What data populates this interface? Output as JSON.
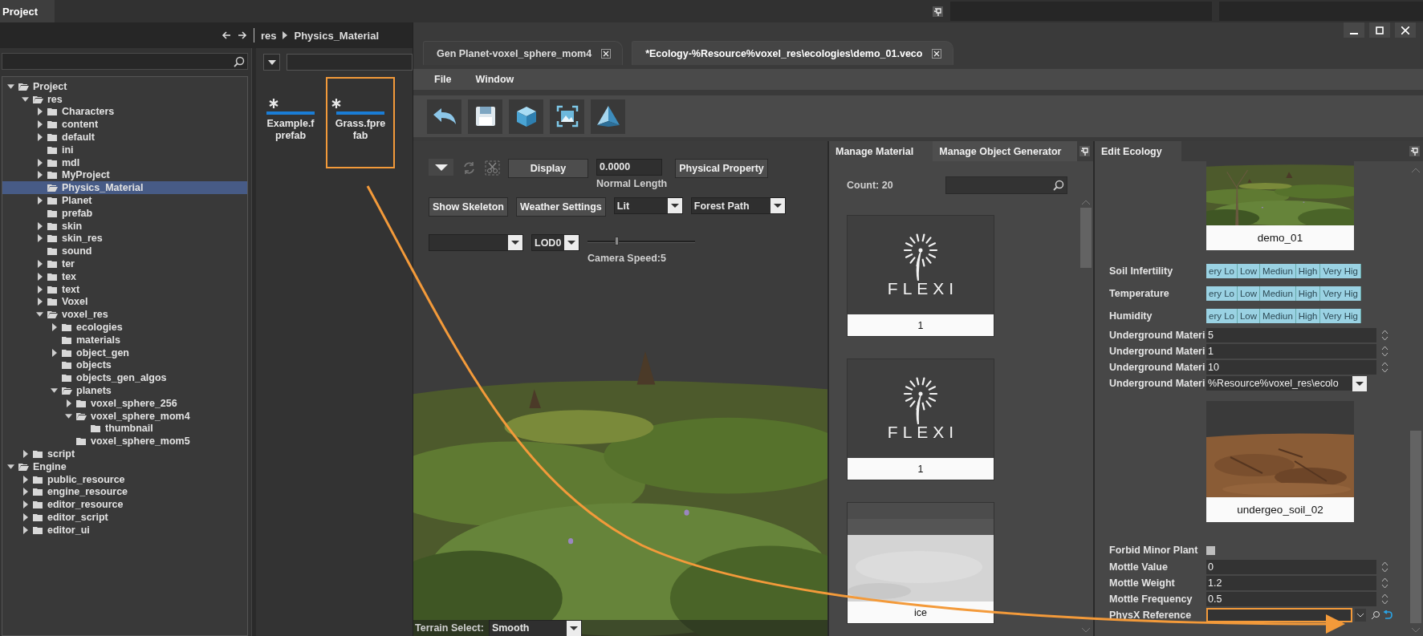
{
  "top_bar": {
    "panel_tab": "Project"
  },
  "breadcrumb": {
    "path": [
      "res",
      "Physics_Material"
    ]
  },
  "project_tree": {
    "items": [
      {
        "label": "Project",
        "expandable": true,
        "expanded": true,
        "selected": false,
        "children": [
          {
            "label": "res",
            "expandable": true,
            "expanded": true,
            "selected": false,
            "children": [
              {
                "label": "Characters",
                "expandable": true,
                "expanded": false,
                "selected": false
              },
              {
                "label": "content",
                "expandable": true,
                "expanded": false,
                "selected": false
              },
              {
                "label": "default",
                "expandable": true,
                "expanded": false,
                "selected": false
              },
              {
                "label": "ini",
                "expandable": false,
                "expanded": false,
                "selected": false
              },
              {
                "label": "mdl",
                "expandable": true,
                "expanded": false,
                "selected": false
              },
              {
                "label": "MyProject",
                "expandable": true,
                "expanded": false,
                "selected": false
              },
              {
                "label": "Physics_Material",
                "expandable": false,
                "expanded": false,
                "selected": true
              },
              {
                "label": "Planet",
                "expandable": true,
                "expanded": false,
                "selected": false
              },
              {
                "label": "prefab",
                "expandable": false,
                "expanded": false,
                "selected": false
              },
              {
                "label": "skin",
                "expandable": true,
                "expanded": false,
                "selected": false
              },
              {
                "label": "skin_res",
                "expandable": true,
                "expanded": false,
                "selected": false
              },
              {
                "label": "sound",
                "expandable": false,
                "expanded": false,
                "selected": false
              },
              {
                "label": "ter",
                "expandable": true,
                "expanded": false,
                "selected": false
              },
              {
                "label": "tex",
                "expandable": true,
                "expanded": false,
                "selected": false
              },
              {
                "label": "text",
                "expandable": true,
                "expanded": false,
                "selected": false
              },
              {
                "label": "Voxel",
                "expandable": true,
                "expanded": false,
                "selected": false
              },
              {
                "label": "voxel_res",
                "expandable": true,
                "expanded": true,
                "selected": false,
                "children": [
                  {
                    "label": "ecologies",
                    "expandable": true,
                    "expanded": false,
                    "selected": false
                  },
                  {
                    "label": "materials",
                    "expandable": false,
                    "expanded": false,
                    "selected": false
                  },
                  {
                    "label": "object_gen",
                    "expandable": true,
                    "expanded": false,
                    "selected": false
                  },
                  {
                    "label": "objects",
                    "expandable": false,
                    "expanded": false,
                    "selected": false
                  },
                  {
                    "label": "objects_gen_algos",
                    "expandable": false,
                    "expanded": false,
                    "selected": false
                  },
                  {
                    "label": "planets",
                    "expandable": true,
                    "expanded": true,
                    "selected": false,
                    "children": [
                      {
                        "label": "voxel_sphere_256",
                        "expandable": true,
                        "expanded": false,
                        "selected": false
                      },
                      {
                        "label": "voxel_sphere_mom4",
                        "expandable": true,
                        "expanded": true,
                        "selected": false,
                        "children": [
                          {
                            "label": "thumbnail",
                            "expandable": false,
                            "expanded": false,
                            "selected": false
                          }
                        ]
                      },
                      {
                        "label": "voxel_sphere_mom5",
                        "expandable": false,
                        "expanded": false,
                        "selected": false
                      }
                    ]
                  }
                ]
              }
            ]
          },
          {
            "label": "script",
            "expandable": true,
            "expanded": false,
            "selected": false
          }
        ]
      },
      {
        "label": "Engine",
        "expandable": true,
        "expanded": true,
        "selected": false,
        "children": [
          {
            "label": "public_resource",
            "expandable": true,
            "expanded": false,
            "selected": false
          },
          {
            "label": "engine_resource",
            "expandable": true,
            "expanded": false,
            "selected": false
          },
          {
            "label": "editor_resource",
            "expandable": true,
            "expanded": false,
            "selected": false
          },
          {
            "label": "editor_script",
            "expandable": true,
            "expanded": false,
            "selected": false
          },
          {
            "label": "editor_ui",
            "expandable": true,
            "expanded": false,
            "selected": false
          }
        ]
      }
    ]
  },
  "file_browser": {
    "files": [
      {
        "name_lines": [
          "Example.f",
          "prefab"
        ],
        "highlighted": false
      },
      {
        "name_lines": [
          "Grass.fpre",
          "fab"
        ],
        "highlighted": true
      }
    ]
  },
  "editor": {
    "tabs": [
      {
        "label": "Gen Planet-voxel_sphere_mom4",
        "selected": false
      },
      {
        "label": "*Ecology-%Resource%voxel_res\\ecologies\\demo_01.veco",
        "selected": true
      }
    ],
    "menu": [
      "File",
      "Window"
    ]
  },
  "viewport": {
    "display_button": "Display",
    "normal_length": {
      "value": "0.0000",
      "label": "Normal Length"
    },
    "physical_property_button": "Physical Property",
    "show_skeleton_button": "Show Skeleton",
    "weather_settings_button": "Weather Settings",
    "shading_dropdown": "Lit",
    "scene_dropdown": "Forest Path",
    "lod_dropdown": "LOD0",
    "camera_speed": {
      "label": "Camera Speed:5",
      "level": 0.27
    },
    "terrain_select": {
      "label": "Terrain Select:",
      "value": "Smooth"
    }
  },
  "materials": {
    "tabs": [
      {
        "label": "Manage Material",
        "selected": true
      },
      {
        "label": "Manage Object Generator",
        "selected": false
      }
    ],
    "count": "Count: 20",
    "items": [
      {
        "label": "1",
        "kind": "logo",
        "logo_text": "FLEXI"
      },
      {
        "label": "1",
        "kind": "logo",
        "logo_text": "FLEXI"
      },
      {
        "label": "ice",
        "kind": "picture"
      }
    ]
  },
  "ecology": {
    "title": "Edit Ecology",
    "rows": [
      {
        "kind": "preview",
        "label": "demo_01"
      },
      {
        "kind": "levels",
        "label": "Soil Infertility",
        "options": [
          "ery Lo",
          "Low",
          "Mediun",
          "High",
          "Very Hig"
        ]
      },
      {
        "kind": "levels",
        "label": "Temperature",
        "options": [
          "ery Lo",
          "Low",
          "Mediun",
          "High",
          "Very Hig"
        ]
      },
      {
        "kind": "levels",
        "label": "Humidity",
        "options": [
          "ery Lo",
          "Low",
          "Mediun",
          "High",
          "Very Hig"
        ]
      },
      {
        "kind": "number",
        "label": "Underground Materi",
        "value": "5"
      },
      {
        "kind": "number",
        "label": "Underground Materi",
        "value": "1"
      },
      {
        "kind": "number",
        "label": "Underground Materi",
        "value": "10"
      },
      {
        "kind": "dropdown",
        "label": "Underground Materi",
        "value": "%Resource%voxel_res\\ecolo"
      },
      {
        "kind": "preview",
        "label": "undergeo_soil_02"
      },
      {
        "kind": "checkbox",
        "label": "Forbid Minor Plant",
        "checked": false
      },
      {
        "kind": "number",
        "label": "Mottle Value",
        "value": "0"
      },
      {
        "kind": "number",
        "label": "Mottle Weight",
        "value": "1.2"
      },
      {
        "kind": "number",
        "label": "Mottle Frequency",
        "value": "0.5"
      },
      {
        "kind": "reference",
        "label": "PhysX Reference",
        "highlighted": true
      }
    ]
  }
}
